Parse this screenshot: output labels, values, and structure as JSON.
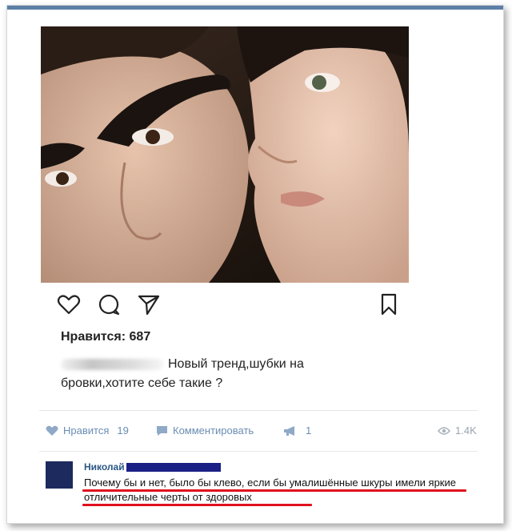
{
  "post": {
    "ig": {
      "likes": "Нравится: 687",
      "caption": "Новый тренд,шубки на бровки,хотите себе такие ?",
      "icons": [
        "heart-icon",
        "comment-bubble-icon",
        "send-icon",
        "bookmark-icon"
      ]
    },
    "vk": {
      "like_label": "Нравится",
      "like_count": "19",
      "comment_label": "Комментировать",
      "share_count": "1",
      "views": "1.4K"
    },
    "comment": {
      "author": "Николай",
      "text": "Почему бы и нет, было бы клево, если бы умалишённые шкуры имели яркие отличительные черты от здоровых"
    }
  },
  "colors": {
    "accent_bar": "#5b7fa6",
    "vk_link": "#6b8db3",
    "author": "#2a5885",
    "redaction": "#1a1f86",
    "underline": "#e0111e"
  }
}
